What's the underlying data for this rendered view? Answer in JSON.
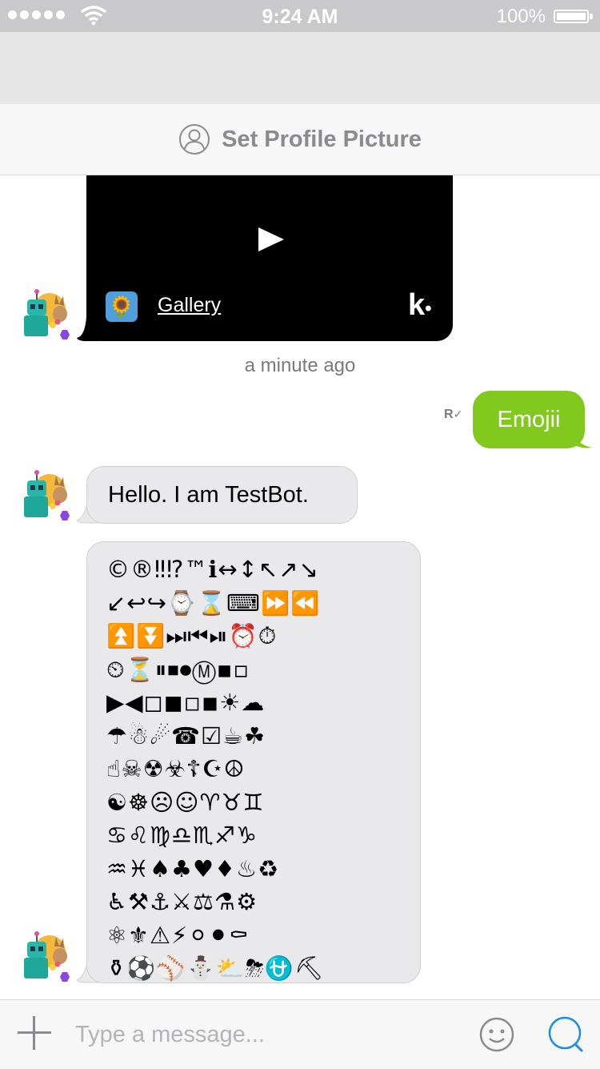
{
  "status_bar": {
    "time": "9:24 AM",
    "battery": "100%",
    "icons": [
      "signal-icon",
      "wifi-icon",
      "battery-icon"
    ]
  },
  "header": {
    "set_profile_label": "Set Profile Picture",
    "icon": "person-circle-icon"
  },
  "messages": {
    "video": {
      "source_label": "Gallery",
      "brand": "k",
      "icons": [
        "play-icon",
        "gallery-sunflower-icon",
        "kik-logo"
      ]
    },
    "timestamp": "a minute ago",
    "outgoing": {
      "text": "Emojii",
      "receipt": "R",
      "color": "#82c91e"
    },
    "incoming_text": "Hello. I am TestBot.",
    "emoji_lines": [
      "©®‼⁉™ℹ↔↕↖↗↘",
      "↙↩↪⌚⌛⌨⏩⏪",
      "⏫⏬⏭⏮⏯⏰⏱",
      "⏲⏳⏸⏹⏺Ⓜ▪▫",
      "▶◀◻◼◽◾☀☁",
      "☂☃☄☎☑☕☘",
      "☝☠☢☣☦☪☮",
      "☯☸☹☺♈♉♊",
      "♋♌♍♎♏♐♑",
      "♒♓♠♣♥♦♨♻",
      "♿⚒⚓⚔⚖⚗⚙",
      "⚛⚜⚠⚡⚪⚫⚰",
      "⚱⚽⚾⛄⛅⛈⛎⛏"
    ]
  },
  "composer": {
    "placeholder": "Type a message...",
    "icons": [
      "plus-icon",
      "smiley-icon",
      "search-icon"
    ],
    "accent": "#1a8fe0"
  }
}
